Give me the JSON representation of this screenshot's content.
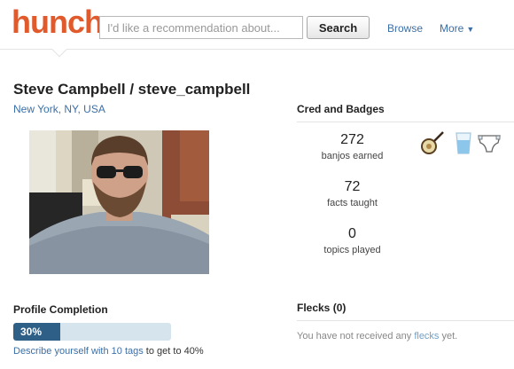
{
  "header": {
    "logo": "hunch",
    "search_placeholder": "I'd like a recommendation about...",
    "search_button": "Search",
    "nav_browse": "Browse",
    "nav_more": "More",
    "nav_more_icon": "chevron-down-icon"
  },
  "profile": {
    "name": "Steve Campbell / steve_campbell",
    "location": "New York, NY, USA"
  },
  "completion": {
    "title": "Profile Completion",
    "percent_label": "30%",
    "percent": 30,
    "tip_prefix": "Describe yourself with ",
    "tip_count": "10 tags",
    "tip_middle": " to get to ",
    "tip_target": "40%"
  },
  "cred": {
    "title": "Cred and Badges",
    "stats": [
      {
        "value": "272",
        "label": "banjos earned"
      },
      {
        "value": "72",
        "label": "facts taught"
      },
      {
        "value": "0",
        "label": "topics played"
      }
    ],
    "badges": [
      "banjo-icon",
      "water-glass-icon",
      "diaper-icon"
    ]
  },
  "flecks": {
    "title": "Flecks (0)",
    "empty_prefix": "You have not received any ",
    "empty_link": "flecks",
    "empty_suffix": " yet."
  },
  "colors": {
    "brand": "#e05a2b",
    "link": "#3a6fa8",
    "progress_fill": "#2e5f87",
    "progress_track": "#d6e4ee"
  }
}
